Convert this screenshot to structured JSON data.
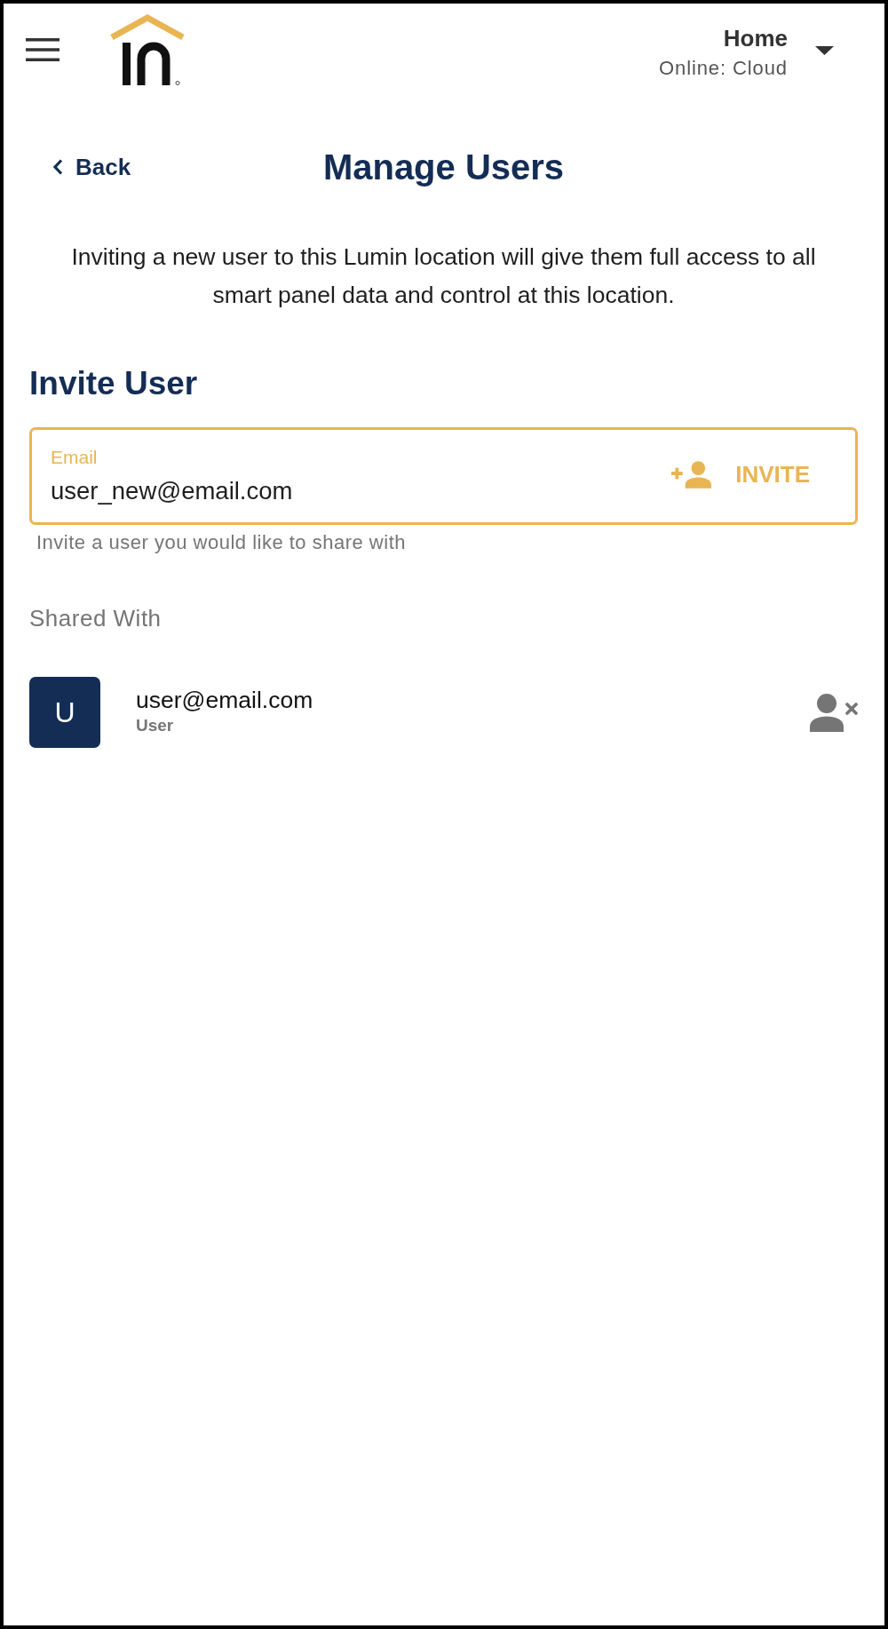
{
  "header": {
    "location": {
      "name": "Home",
      "status": "Online: Cloud"
    }
  },
  "page": {
    "back": "Back",
    "title": "Manage Users",
    "description": "Inviting a new user to this Lumin location will give them full access to all smart panel data and control at this location."
  },
  "invite": {
    "heading": "Invite User",
    "field": {
      "label": "Email",
      "value": "user_new@email.com",
      "focused": true
    },
    "button": "INVITE",
    "helper": "Invite a user you would like to share with"
  },
  "shared": {
    "heading": "Shared With",
    "users": [
      {
        "initial": "U",
        "email": "user@email.com",
        "role": "User"
      }
    ]
  }
}
